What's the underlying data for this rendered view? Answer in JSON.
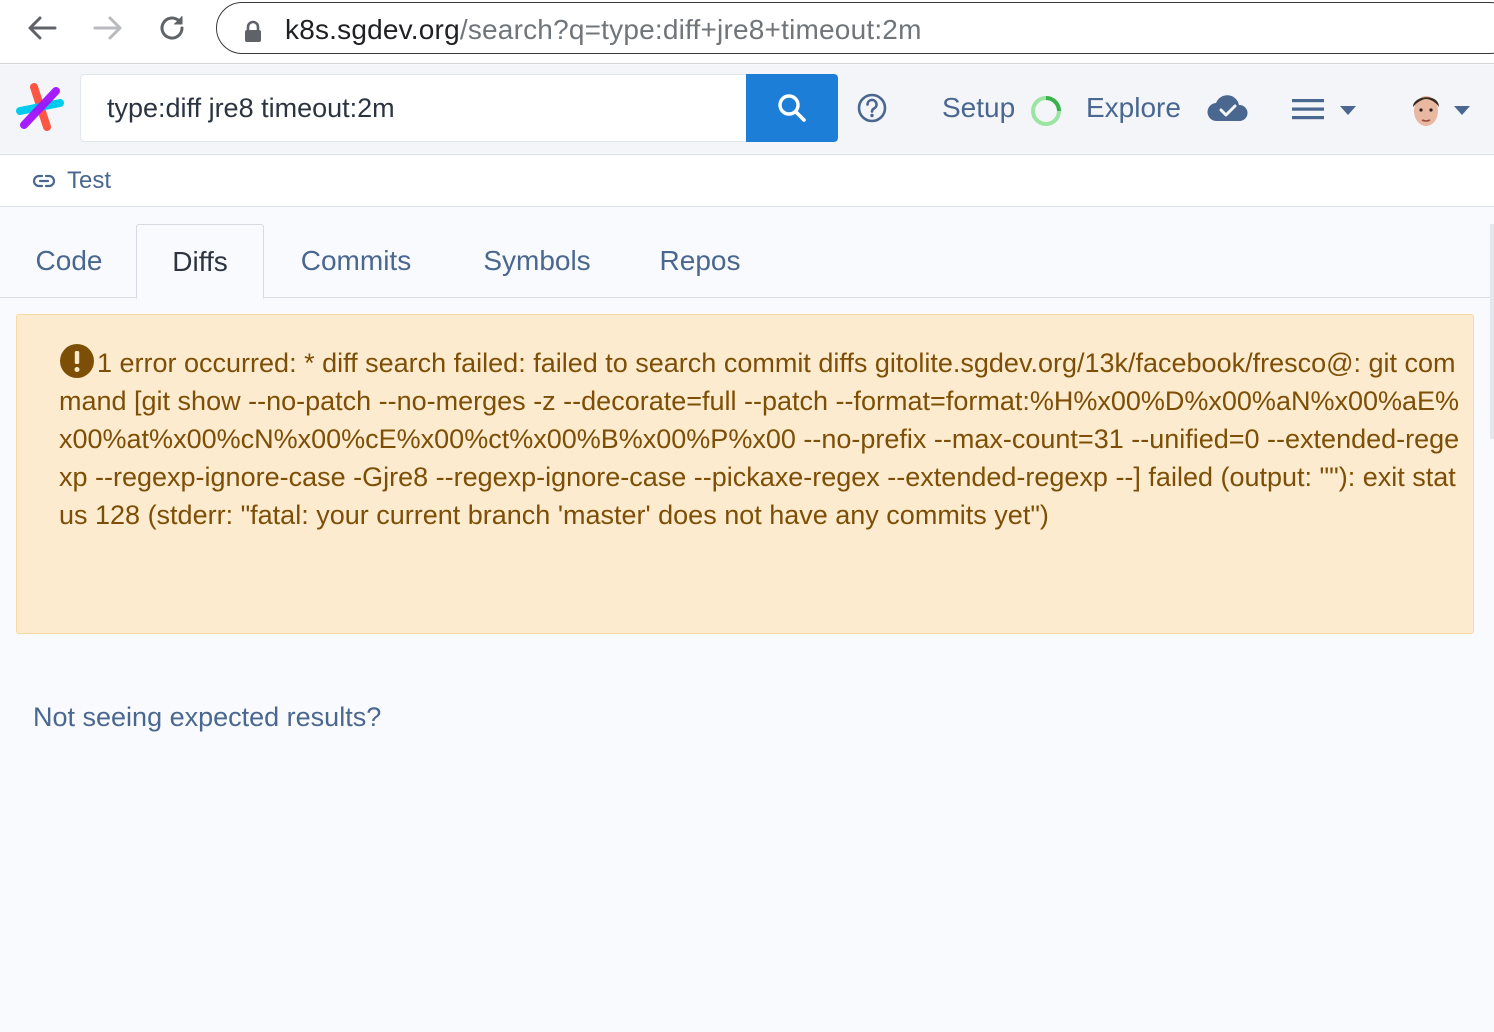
{
  "browser": {
    "url_host": "k8s.sgdev.org",
    "url_path": "/search?q=type:diff+jre8+timeout:2m"
  },
  "header": {
    "search_value": "type:diff jre8 timeout:2m",
    "setup_label": "Setup",
    "explore_label": "Explore"
  },
  "saved_query": {
    "label": "Test"
  },
  "tabs": [
    {
      "label": "Code"
    },
    {
      "label": "Diffs"
    },
    {
      "label": "Commits"
    },
    {
      "label": "Symbols"
    },
    {
      "label": "Repos"
    }
  ],
  "active_tab": "Diffs",
  "alert": {
    "message": "1 error occurred: * diff search failed: failed to search commit diffs gitolite.sgdev.org/13k/facebook/fresco@: git command [git show --no-patch --no-merges -z --decorate=full --patch --format=format:%H%x00%D%x00%aN%x00%aE%x00%at%x00%cN%x00%cE%x00%ct%x00%B%x00%P%x00 --no-prefix --max-count=31 --unified=0 --extended-regexp --regexp-ignore-case -Gjre8 --regexp-ignore-case --pickaxe-regex --extended-regexp --] failed (output: \"\"): exit status 128 (stderr: \"fatal: your current branch 'master' does not have any commits yet\")"
  },
  "footer_link": "Not seeing expected results?",
  "colors": {
    "accent": "#1c7ed6",
    "link": "#4a6790",
    "alert_bg": "#fdebcf",
    "alert_text": "#7d4f06"
  }
}
